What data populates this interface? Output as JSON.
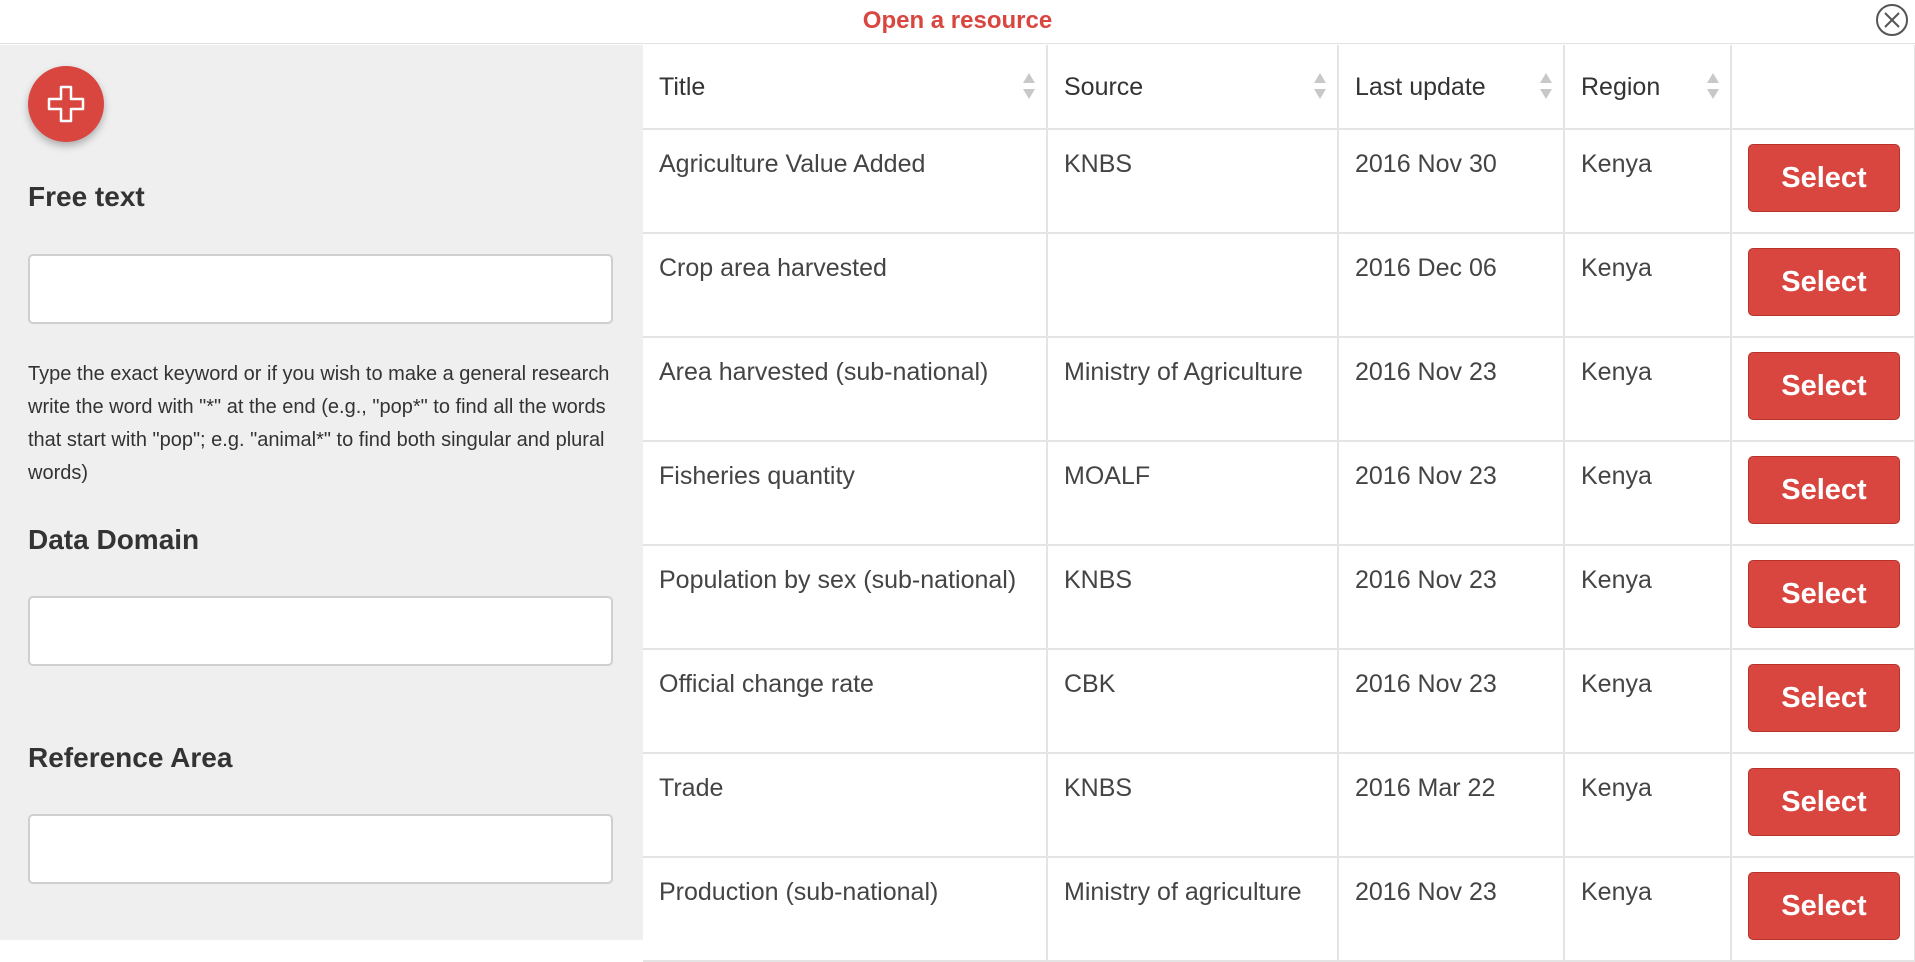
{
  "header": {
    "title": "Open a resource"
  },
  "sidebar": {
    "free_text": {
      "label": "Free text",
      "value": ""
    },
    "help_text": "Type the exact keyword or if you wish to make a general research write the word with \"*\" at the end (e.g., \"pop*\" to find all the words that start with \"pop\"; e.g. \"animal*\" to find both singular and plural words)",
    "data_domain": {
      "label": "Data Domain",
      "value": ""
    },
    "reference_area": {
      "label": "Reference Area",
      "value": ""
    }
  },
  "table": {
    "columns": [
      "Title",
      "Source",
      "Last update",
      "Region"
    ],
    "select_label": "Select",
    "rows": [
      {
        "title": "Agriculture Value Added",
        "source": "KNBS",
        "last_update": "2016 Nov 30",
        "region": "Kenya"
      },
      {
        "title": "Crop area harvested",
        "source": "",
        "last_update": "2016 Dec 06",
        "region": "Kenya"
      },
      {
        "title": "Area harvested (sub-national)",
        "source": "Ministry of Agriculture",
        "last_update": "2016 Nov 23",
        "region": "Kenya"
      },
      {
        "title": "Fisheries quantity",
        "source": "MOALF",
        "last_update": "2016 Nov 23",
        "region": "Kenya"
      },
      {
        "title": "Population by sex (sub-national)",
        "source": "KNBS",
        "last_update": "2016 Nov 23",
        "region": "Kenya"
      },
      {
        "title": "Official change rate",
        "source": "CBK",
        "last_update": "2016 Nov 23",
        "region": "Kenya"
      },
      {
        "title": "Trade",
        "source": "KNBS",
        "last_update": "2016 Mar 22",
        "region": "Kenya"
      },
      {
        "title": "Production (sub-national)",
        "source": "Ministry of agriculture",
        "last_update": "2016 Nov 23",
        "region": "Kenya"
      }
    ]
  },
  "icons": {
    "close": "close-icon",
    "add": "plus-icon",
    "sort": "sort-icon"
  },
  "colors": {
    "accent": "#d9463f",
    "sidebar_bg": "#efefef",
    "border": "#e4e4e4"
  }
}
